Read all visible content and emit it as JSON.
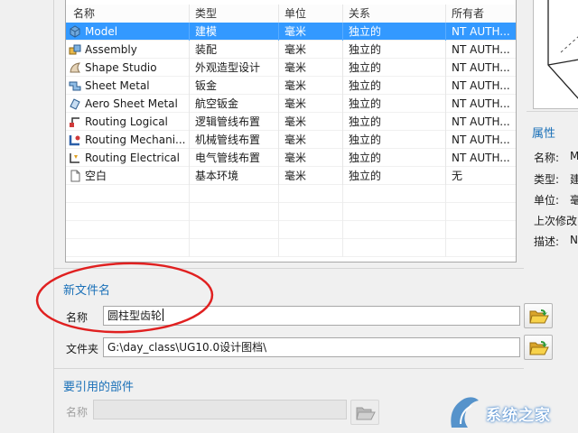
{
  "table": {
    "headers": [
      "名称",
      "类型",
      "单位",
      "关系",
      "所有者"
    ],
    "rows": [
      {
        "name": "Model",
        "type": "建模",
        "unit": "毫米",
        "relation": "独立的",
        "owner": "NT AUTH...",
        "icon": "model-icon",
        "selected": true
      },
      {
        "name": "Assembly",
        "type": "装配",
        "unit": "毫米",
        "relation": "独立的",
        "owner": "NT AUTH...",
        "icon": "assembly-icon"
      },
      {
        "name": "Shape Studio",
        "type": "外观造型设计",
        "unit": "毫米",
        "relation": "独立的",
        "owner": "NT AUTH...",
        "icon": "shape-studio-icon"
      },
      {
        "name": "Sheet Metal",
        "type": "钣金",
        "unit": "毫米",
        "relation": "独立的",
        "owner": "NT AUTH...",
        "icon": "sheet-metal-icon"
      },
      {
        "name": "Aero Sheet Metal",
        "type": "航空钣金",
        "unit": "毫米",
        "relation": "独立的",
        "owner": "NT AUTH...",
        "icon": "aero-sheet-metal-icon"
      },
      {
        "name": "Routing Logical",
        "type": "逻辑管线布置",
        "unit": "毫米",
        "relation": "独立的",
        "owner": "NT AUTH...",
        "icon": "routing-logical-icon"
      },
      {
        "name": "Routing Mechani...",
        "type": "机械管线布置",
        "unit": "毫米",
        "relation": "独立的",
        "owner": "NT AUTH...",
        "icon": "routing-mechanical-icon"
      },
      {
        "name": "Routing Electrical",
        "type": "电气管线布置",
        "unit": "毫米",
        "relation": "独立的",
        "owner": "NT AUTH...",
        "icon": "routing-electrical-icon"
      },
      {
        "name": "空白",
        "type": "基本环境",
        "unit": "毫米",
        "relation": "独立的",
        "owner": "无",
        "icon": "blank-file-icon"
      }
    ]
  },
  "properties": {
    "title": "属性",
    "items": [
      {
        "label": "名称:",
        "value": "M"
      },
      {
        "label": "类型:",
        "value": "建"
      },
      {
        "label": "单位:",
        "value": "毫"
      },
      {
        "label": "上次修改",
        "value": ""
      },
      {
        "label": "描述:",
        "value": "N"
      }
    ]
  },
  "new_filename": {
    "title": "新文件名",
    "name_label": "名称",
    "name_value": "圆柱型齿轮",
    "folder_label": "文件夹",
    "folder_value": "G:\\day_class\\UG10.0设计图档\\"
  },
  "referenced_part": {
    "title": "要引用的部件",
    "name_label": "名称",
    "name_value": ""
  },
  "colors": {
    "accent": "#1a70b8",
    "selection": "#3399ff",
    "annotation": "#e02020"
  },
  "watermark": {
    "text": "系统之家"
  }
}
